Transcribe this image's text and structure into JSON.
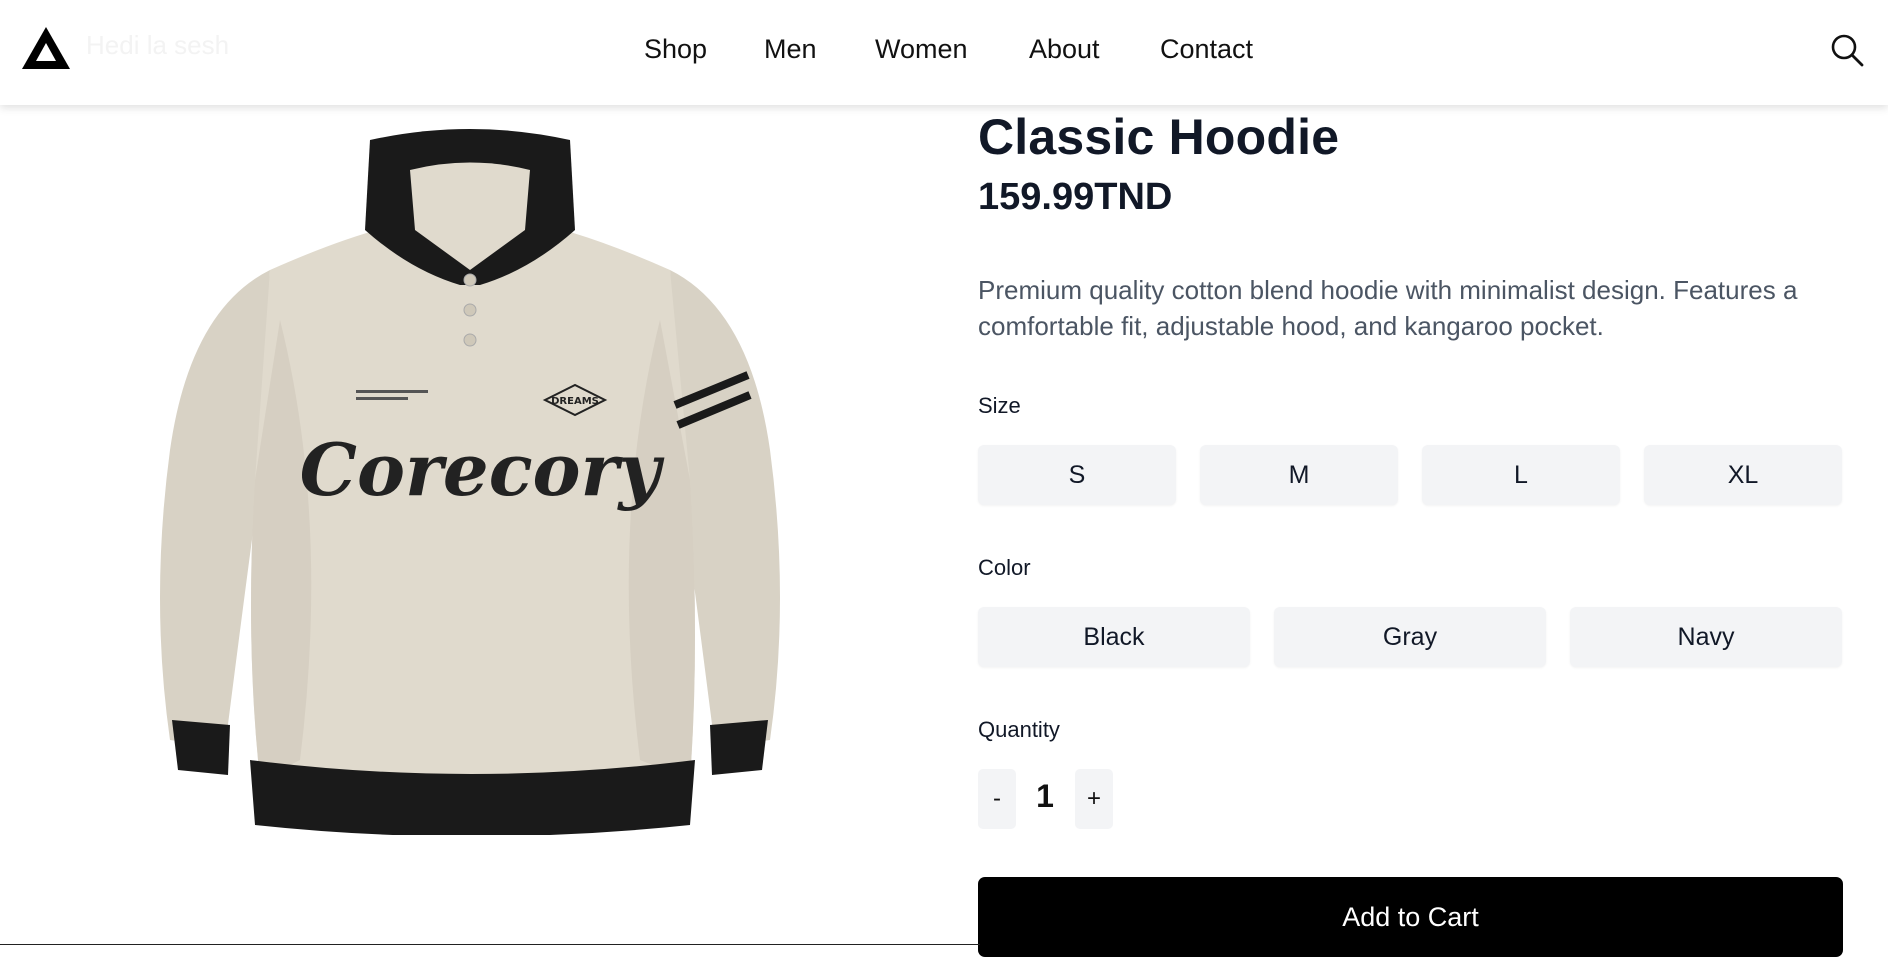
{
  "header": {
    "brand": "Hedi la sesh",
    "nav": [
      "Shop",
      "Men",
      "Women",
      "About",
      "Contact"
    ],
    "logo_icon": "triangle-logo-icon",
    "search_icon": "search-icon"
  },
  "product": {
    "title": "Classic Hoodie",
    "price": "159.99TND",
    "description": "Premium quality cotton blend hoodie with minimalist design. Features a comfortable fit, adjustable hood, and kangaroo pocket.",
    "image_text": "Corecory",
    "image_badge": "DREAMS"
  },
  "size": {
    "label": "Size",
    "options": [
      "S",
      "M",
      "L",
      "XL"
    ]
  },
  "color": {
    "label": "Color",
    "options": [
      "Black",
      "Gray",
      "Navy"
    ]
  },
  "quantity": {
    "label": "Quantity",
    "value": "1",
    "decrement": "-",
    "increment": "+"
  },
  "cta": {
    "add_to_cart": "Add to Cart"
  },
  "colors": {
    "accent": "#000000",
    "option_bg": "#f3f4f6",
    "text_dark": "#111827",
    "text_muted": "#4b5563"
  }
}
